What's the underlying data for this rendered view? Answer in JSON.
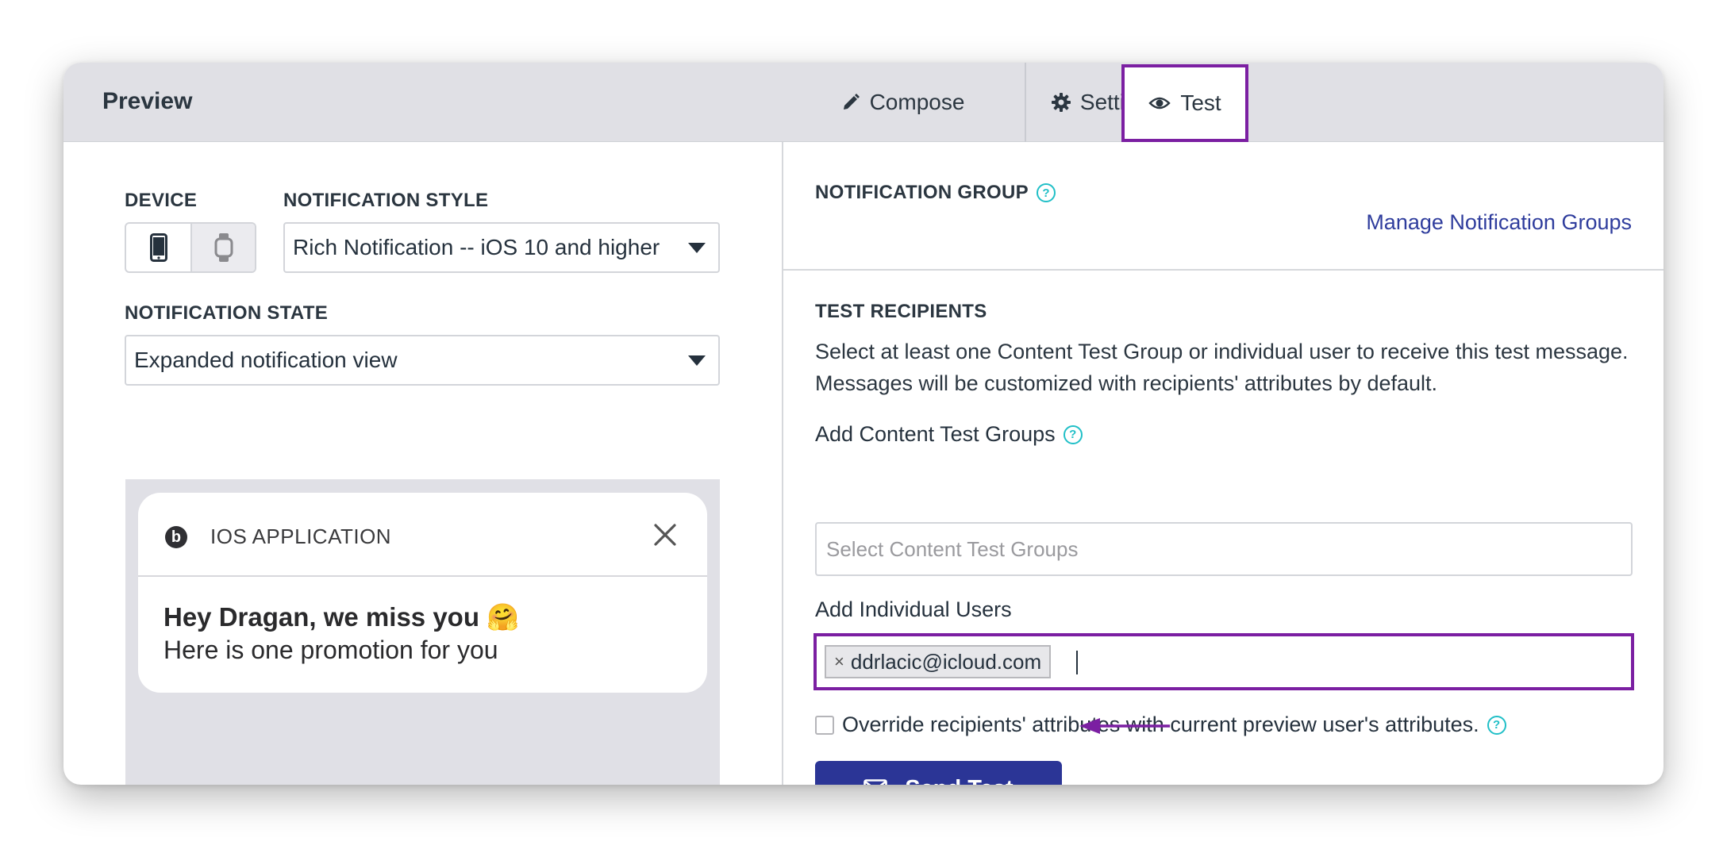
{
  "header": {
    "title": "Preview",
    "tabs": [
      {
        "label": "Compose",
        "icon": "pencil-icon"
      },
      {
        "label": "Settings",
        "icon": "gear-icon"
      },
      {
        "label": "Test",
        "icon": "eye-icon",
        "active": true
      }
    ]
  },
  "left": {
    "device_label": "DEVICE",
    "device_options": [
      "phone-icon",
      "watch-icon"
    ],
    "style_label": "NOTIFICATION STYLE",
    "style_value": "Rich Notification -- iOS 10 and higher",
    "state_label": "NOTIFICATION STATE",
    "state_value": "Expanded notification view",
    "notification": {
      "app_name": "IOS APPLICATION",
      "app_icon_glyph": "b",
      "title": "Hey Dragan, we miss you 🤗",
      "body": "Here is one promotion for you"
    }
  },
  "right": {
    "group_label": "NOTIFICATION GROUP",
    "manage_link": "Manage Notification Groups",
    "recipients_label": "TEST RECIPIENTS",
    "recipients_desc": "Select at least one Content Test Group or individual user to receive this test message. Messages will be customized with recipients' attributes by default.",
    "content_groups_label": "Add Content Test Groups",
    "content_groups_placeholder": "Select Content Test Groups",
    "individual_users_label": "Add Individual Users",
    "individual_users": [
      "ddrlacic@icloud.com"
    ],
    "chip_remove": "×",
    "override_label": "Override recipients' attributes with current preview user's attributes.",
    "help_glyph": "?",
    "send_button": "Send Test"
  },
  "colors": {
    "highlight": "#7b1fa2",
    "primary": "#2b3596",
    "link": "#2f3d9d",
    "help": "#20bfc7",
    "header_bg": "#e0e0e5"
  }
}
